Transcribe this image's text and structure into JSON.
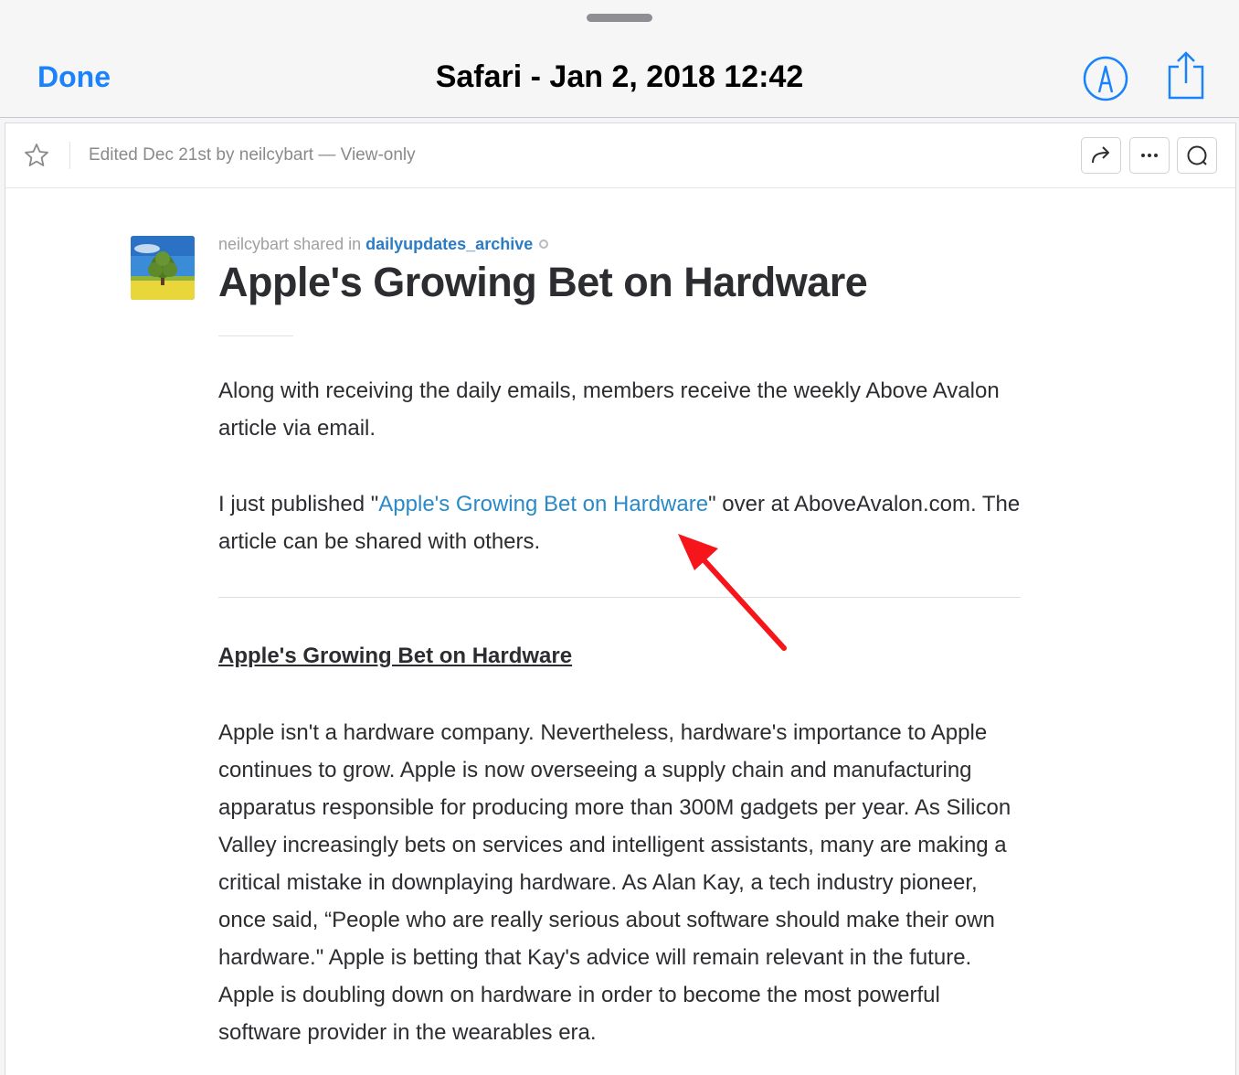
{
  "header": {
    "done_label": "Done",
    "title": "Safari - Jan 2, 2018 12:42"
  },
  "docbar": {
    "edited_text": "Edited Dec 21st by neilcybart — View-only"
  },
  "post": {
    "author": "neilcybart",
    "shared_in_text": "shared in",
    "channel": "dailyupdates_archive",
    "title": "Apple's Growing Bet on Hardware",
    "intro": "Along with receiving the daily emails, members receive the weekly Above Avalon article via email.",
    "published_prefix": "I just published \"",
    "published_link": "Apple's Growing Bet on Hardware",
    "published_suffix": "\" over at  AboveAvalon.com. The article can be shared with others.",
    "subheading": "Apple's Growing Bet on Hardware",
    "body": "Apple isn't a hardware company. Nevertheless, hardware's importance to Apple continues to grow. Apple is now overseeing a supply chain and manufacturing apparatus responsible for producing more than 300M gadgets per year. As Silicon Valley increasingly bets on services and intelligent assistants, many are making a critical mistake in downplaying hardware. As Alan Kay, a tech industry pioneer, once said, “People who are really serious about software should make their own hardware.\" Apple is betting that Kay's advice will remain relevant in the future. Apple is doubling down on hardware in order to become the most powerful software provider in the wearables era."
  },
  "colors": {
    "ios_blue": "#1a82fb",
    "link_blue": "#2a8ac8",
    "annotation_red": "#f5151b"
  },
  "icons": [
    "markup-icon",
    "share-icon",
    "star-icon",
    "forward-icon",
    "more-icon",
    "comment-icon",
    "red-arrow-annotation"
  ]
}
